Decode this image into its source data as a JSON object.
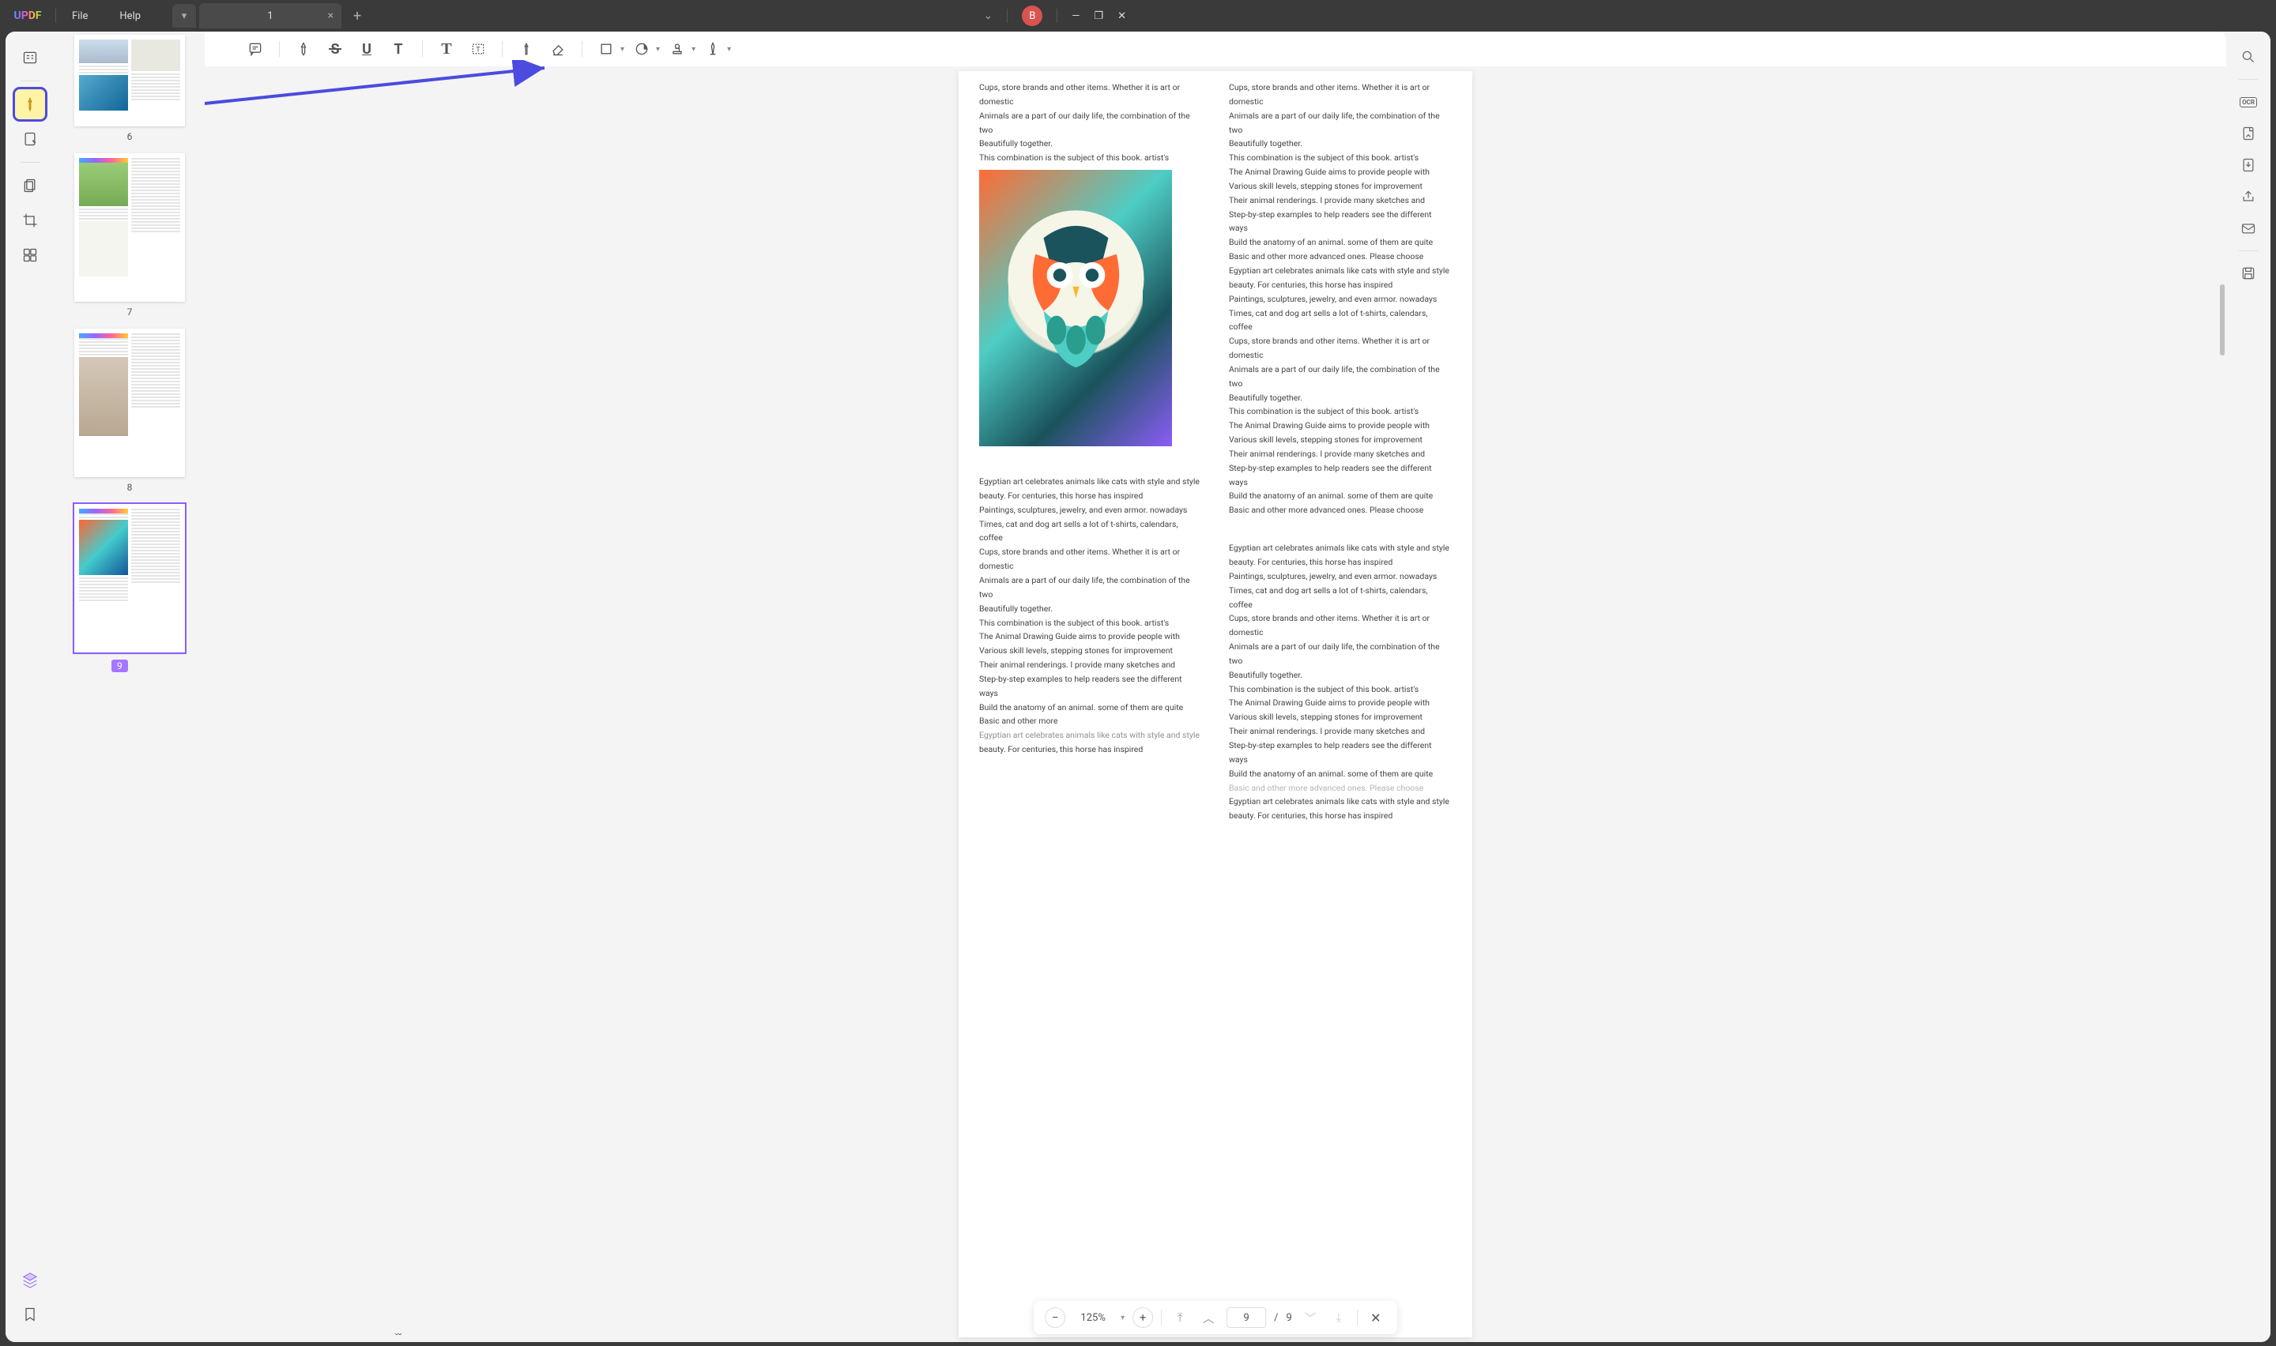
{
  "app": {
    "logo": "UPDF"
  },
  "menu": {
    "file": "File",
    "help": "Help"
  },
  "tabs": {
    "active_label": "1"
  },
  "win": {
    "avatar_initial": "B"
  },
  "thumbs": [
    {
      "num": "6"
    },
    {
      "num": "7"
    },
    {
      "num": "8"
    },
    {
      "num": "9",
      "selected": true
    }
  ],
  "bottom": {
    "zoom": "125%",
    "page_current": "9",
    "page_sep": "/",
    "page_total": "9"
  },
  "doc": {
    "p1": "Cups, store brands and other items. Whether it is art or domestic",
    "p2": "Animals are a part of our daily life, the combination of the two",
    "p3": "Beautifully together.",
    "p4": "This combination is the subject of this book. artist's",
    "p5": "The Animal Drawing Guide aims to provide people with",
    "p6": "Various skill levels, stepping stones for improvement",
    "p7": "Their animal renderings. I provide many sketches and",
    "p8": "Step-by-step examples to help readers see the different ways",
    "p9": "Build the anatomy of an animal. some of them are quite",
    "p10": "Basic and other more advanced ones. Please choose",
    "p11": "Egyptian art celebrates animals like cats with style and style",
    "p12": "beauty. For centuries, this horse has inspired",
    "p13": "Paintings, sculptures, jewelry, and even armor. nowadays",
    "p14": "Times, cat and dog art sells a lot of t-shirts, calendars, coffee",
    "p15": "Basic and other more"
  }
}
